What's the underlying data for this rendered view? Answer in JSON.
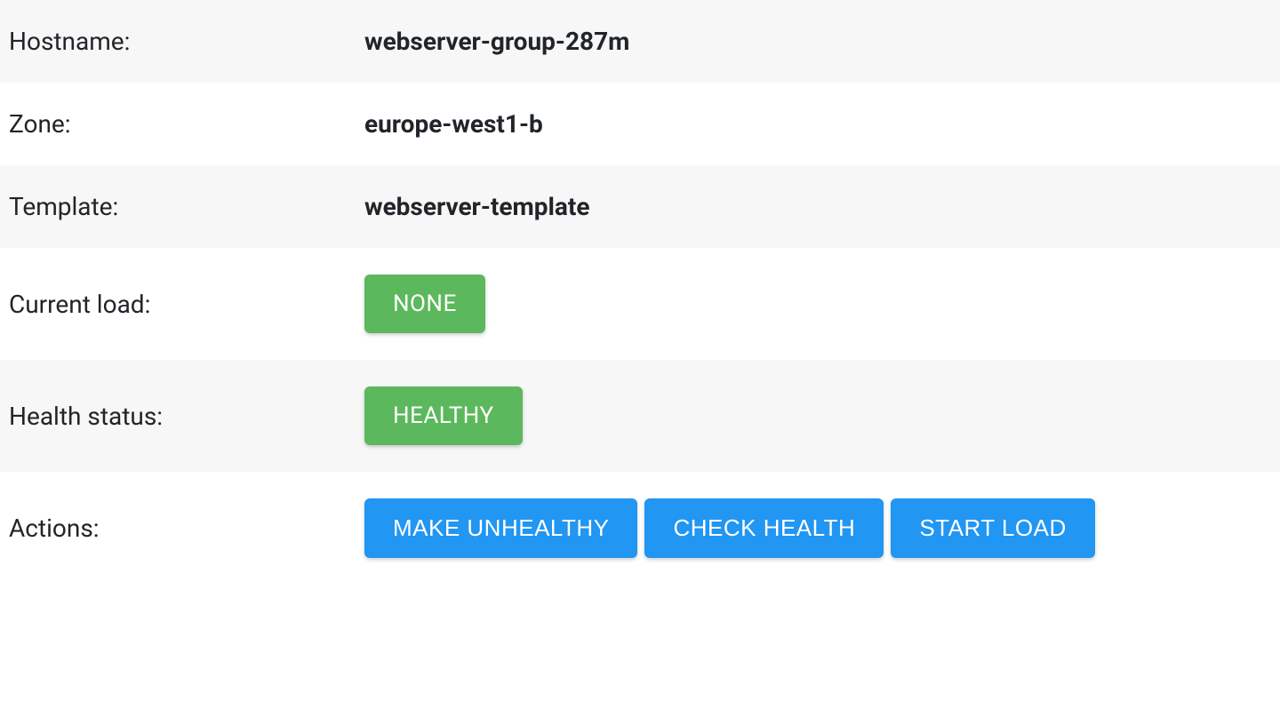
{
  "rows": {
    "hostname": {
      "label": "Hostname:",
      "value": "webserver-group-287m"
    },
    "zone": {
      "label": "Zone:",
      "value": "europe-west1-b"
    },
    "template": {
      "label": "Template:",
      "value": "webserver-template"
    },
    "load": {
      "label": "Current load:",
      "badge": "NONE"
    },
    "health": {
      "label": "Health status:",
      "badge": "HEALTHY"
    },
    "actions": {
      "label": "Actions:",
      "buttons": {
        "make_unhealthy": "MAKE UNHEALTHY",
        "check_health": "CHECK HEALTH",
        "start_load": "START LOAD"
      }
    }
  },
  "colors": {
    "green": "#5cb85c",
    "blue": "#2196f3",
    "stripe": "#f7f7f7"
  }
}
